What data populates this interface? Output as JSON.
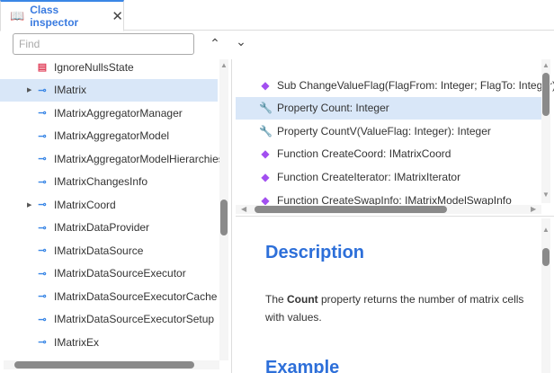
{
  "tab": {
    "title": "Class inspector",
    "close": "✕"
  },
  "search": {
    "placeholder": "Find",
    "value": ""
  },
  "nav": {
    "up": "⌃",
    "down": "⌄"
  },
  "tree": [
    {
      "label": "IgnoreNullsState",
      "icon": "enum",
      "expandable": false
    },
    {
      "label": "IMatrix",
      "icon": "interface",
      "expandable": true,
      "selected": true
    },
    {
      "label": "IMatrixAggregatorManager",
      "icon": "interface"
    },
    {
      "label": "IMatrixAggregatorModel",
      "icon": "interface"
    },
    {
      "label": "IMatrixAggregatorModelHierarchies",
      "icon": "interface"
    },
    {
      "label": "IMatrixChangesInfo",
      "icon": "interface"
    },
    {
      "label": "IMatrixCoord",
      "icon": "interface",
      "expandable": true
    },
    {
      "label": "IMatrixDataProvider",
      "icon": "interface"
    },
    {
      "label": "IMatrixDataSource",
      "icon": "interface"
    },
    {
      "label": "IMatrixDataSourceExecutor",
      "icon": "interface"
    },
    {
      "label": "IMatrixDataSourceExecutorCache",
      "icon": "interface"
    },
    {
      "label": "IMatrixDataSourceExecutorSetup",
      "icon": "interface"
    },
    {
      "label": "IMatrixEx",
      "icon": "interface"
    }
  ],
  "members": [
    {
      "label": "Sub ChangeValueFlag(FlagFrom: Integer; FlagTo: Integer)",
      "icon": "method"
    },
    {
      "label": "Property Count: Integer",
      "icon": "property",
      "selected": true
    },
    {
      "label": "Property CountV(ValueFlag: Integer): Integer",
      "icon": "property"
    },
    {
      "label": "Function CreateCoord: IMatrixCoord",
      "icon": "method"
    },
    {
      "label": "Function CreateIterator: IMatrixIterator",
      "icon": "method"
    },
    {
      "label": "Function CreateSwapInfo: IMatrixModelSwapInfo",
      "icon": "method"
    }
  ],
  "doc": {
    "heading": "Description",
    "text_pre": "The ",
    "text_bold": "Count",
    "text_post": " property returns the number of matrix cells with values.",
    "heading2": "Example"
  },
  "colors": {
    "accent": "#3a87e6",
    "selection": "#d9e7f8",
    "method": "#a24ff0",
    "heading": "#2d6fd9"
  }
}
